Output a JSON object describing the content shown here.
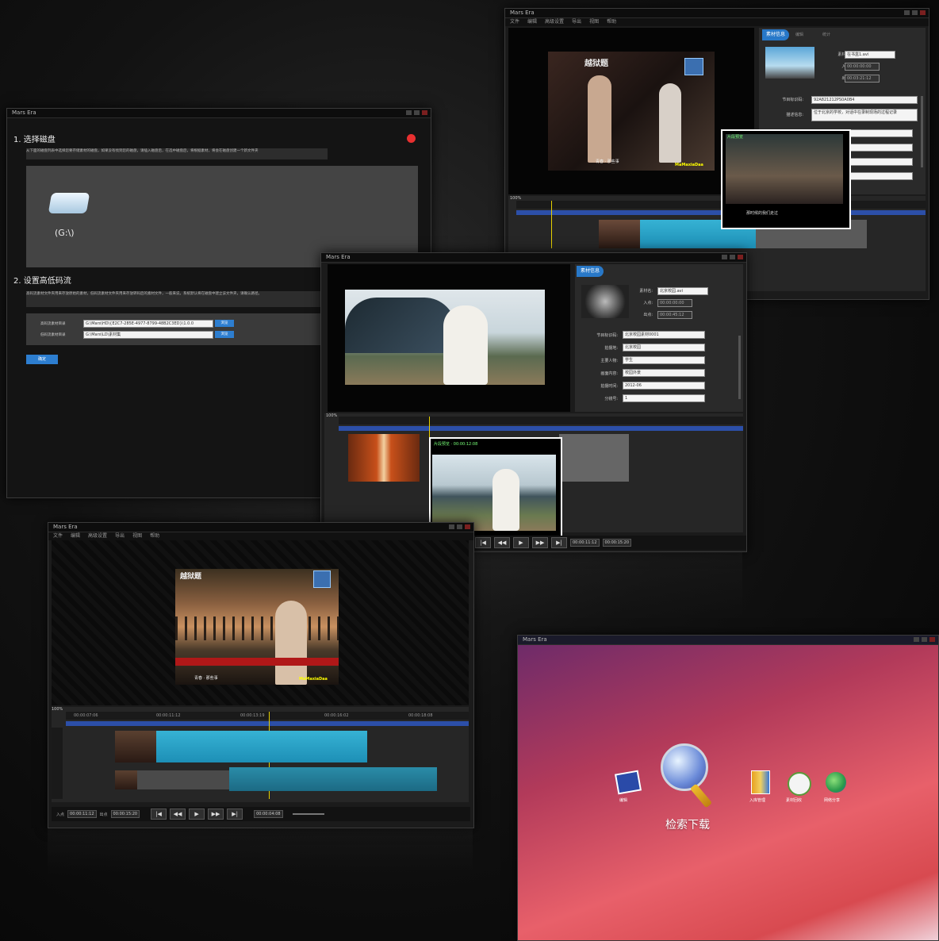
{
  "app_title": "Mars Era",
  "menu": [
    "文件",
    "编辑",
    "高级设置",
    "导出",
    "视图",
    "帮助"
  ],
  "setup_window": {
    "step1_title": "1. 选择磁盘",
    "step1_desc": "从下面的磁盘列表中选择您要存储素材的磁盘，如果没有找到您的磁盘，请插入磁盘后，在选中磁盘后，将根据素材，将会在磁盘创建一个新文件夹",
    "drive_label": "(G:\\)",
    "step2_title": "2. 设置高低码流",
    "step2_desc": "高码流素材文件夹用来存放原始的素材，低码流素材文件夹用来存放转码后的素材文件，一般来说，系统默认将在磁盘中建立该文件夹，请确认路径。",
    "hi_label": "高码流素材目录",
    "hi_value": "G:\\Mars\\HD\\{E2C7-285E-4977-8799-48B2C3ED}\\1.0.0",
    "lo_label": "低码流素材目录",
    "lo_value": "G:\\Mars\\LD\\素材集",
    "browse": "浏览",
    "ok": "确定"
  },
  "editor_top": {
    "subtitle_top": "越狱题",
    "subtitle_bottom": "青春 · 那些事",
    "watermark": "MaMaxiaDaa",
    "tabs": [
      "素材信息",
      "编辑",
      "统计"
    ],
    "fields": [
      {
        "label": "素材名:",
        "value": "在书盒1.avi"
      },
      {
        "label": "入点:",
        "value": "00:00:00:00"
      },
      {
        "label": "出点:",
        "value": "00:03:21:12"
      },
      {
        "label": "节目标识码:",
        "value": "92A821212PS0A0B4"
      },
      {
        "label": "描述信息:",
        "value": "位于北京的学校，对话中在录制现场的过程记录"
      }
    ],
    "zoom": "100%",
    "popup_title": "片段预览",
    "popup_caption": "那时候的我们走过"
  },
  "editor_mid": {
    "tab": "素材信息",
    "fields": [
      {
        "label": "素材名:",
        "value": "北京校园.avi"
      },
      {
        "label": "入点:",
        "value": "00:00:00:00"
      },
      {
        "label": "出点:",
        "value": "00:00:45:12"
      },
      {
        "label": "节目标识码:",
        "value": "北京校园素材0001"
      },
      {
        "label": "拍摄地:",
        "value": "北京校园"
      },
      {
        "label": "主要人物:",
        "value": "学生"
      },
      {
        "label": "画面内容:",
        "value": "校园外景"
      },
      {
        "label": "拍摄时间:",
        "value": "2012-06"
      },
      {
        "label": "分镜号:",
        "value": "1"
      }
    ],
    "zoom": "100%",
    "popup_title": "片段预览 · 00:00:12:08"
  },
  "editor_bottom": {
    "subtitle_top": "越狱题",
    "subtitle_bottom": "青春 · 那些事",
    "watermark": "MaMaxiaDaa",
    "zoom": "100%",
    "ruler": [
      "00:00:07:06",
      "00:00:11:12",
      "00:00:13:19",
      "00:00:16:02",
      "00:00:18:08"
    ],
    "in_label": "入点",
    "out_label": "出点",
    "tc_in": "00:00:11:12",
    "tc_out": "00:00:15:20",
    "duration": "00:00:04:08",
    "play_glyphs": [
      "|◀",
      "◀◀",
      "▶",
      "▶▶",
      "▶|"
    ]
  },
  "launcher": {
    "title": "Mars Era",
    "main_label": "检索下载",
    "icons": [
      {
        "icon": "clapper-icon",
        "label": "编辑"
      },
      {
        "icon": "gift-icon",
        "label": "入库管理"
      },
      {
        "icon": "recycle-icon",
        "label": "素材回收"
      },
      {
        "icon": "globe-icon",
        "label": "网络分享"
      }
    ]
  }
}
